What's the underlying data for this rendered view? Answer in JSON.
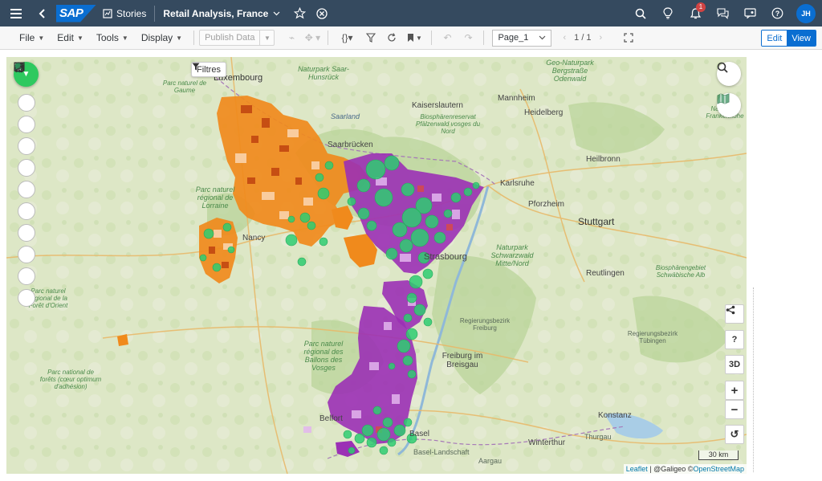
{
  "shell": {
    "brand": "SAP",
    "section": "Stories",
    "title": "Retail Analysis, France",
    "notification_count": "1",
    "user_initials": "JH"
  },
  "toolbar": {
    "file": "File",
    "edit": "Edit",
    "tools": "Tools",
    "display": "Display",
    "publish": "Publish Data",
    "page": "Page_1",
    "pager": "1 / 1",
    "mode_edit": "Edit",
    "mode_view": "View"
  },
  "map": {
    "filter_label": "Filtres",
    "controls": {
      "share": "<",
      "help": "?",
      "three_d": "3D",
      "zoom_in": "+",
      "zoom_out": "−",
      "reset": "↺"
    },
    "scale": "30 km",
    "attribution": {
      "leaflet": "Leaflet",
      "sep": " | @Galigeo ©",
      "osm": "OpenStreetMap"
    },
    "labels": {
      "luxembourg": "Luxembourg",
      "kaiserslautern": "Kaiserslautern",
      "mannheim": "Mannheim",
      "heidelberg": "Heidelberg",
      "saarbrucken": "Saarbrücken",
      "karlsruhe": "Karlsruhe",
      "pforzheim": "Pforzheim",
      "heilbronn": "Heilbronn",
      "stuttgart": "Stuttgart",
      "nancy": "Nancy",
      "strasbourg": "Strasbourg",
      "reutlingen": "Reutlingen",
      "tubingen": "Tübingen",
      "freiburg": "Freiburg im Breisgau",
      "belfort": "Belfort",
      "basel": "Basel",
      "konstanz": "Konstanz",
      "winterthur": "Winterthur",
      "aargau": "Aargau",
      "thurgau": "Thurgau",
      "baselland": "Basel-Landschaft",
      "lorraine": "Parc naturel régional de Lorraine",
      "vosges": "Parc naturel régional des Ballons des Vosges",
      "pfalzerwald": "Biosphärenreservat Pfälzerwald vosges du Nord",
      "schwarzwald": "Naturpark Schwarzwald Mitte/Nord",
      "saar": "Naturpark Saar-Hunsrück",
      "odenwald": "Geo-Naturpark Bergstraße Odenwald",
      "orient": "Parc naturel régional de la Forêt d'Orient",
      "foretsnational": "Parc national de forêts (cœur optimum d'adhésion)",
      "schwabisch": "Biosphärengebiet Schwäbische Alb",
      "saarland": "Saarland",
      "rb_freiburg": "Regierungsbezirk Freiburg",
      "rb_tubingen": "Regierungsbezirk Tübingen",
      "parc_gaume": "Parc naturel de Gaume",
      "frankenhohe": "Naturpark Frankenhöhe"
    }
  },
  "colors": {
    "shell": "#354a5f",
    "accent": "#0a6ed1",
    "orange_region": "#f08a1c",
    "purple_region": "#9b30b5",
    "bubble": "#2ecc71",
    "map_base": "#dfe8c8"
  }
}
